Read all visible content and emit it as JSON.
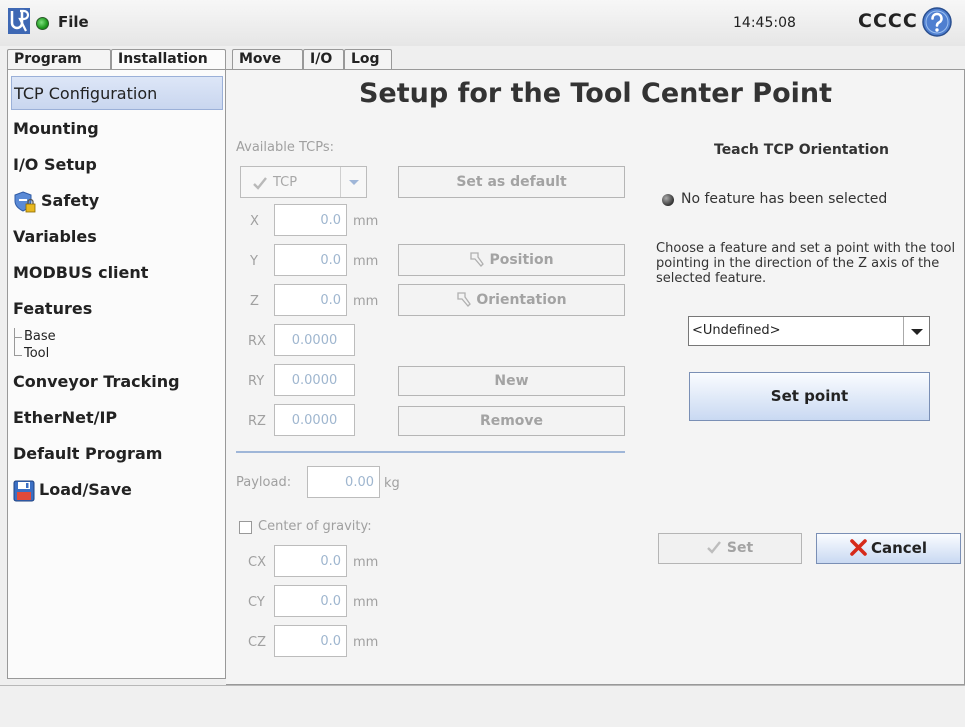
{
  "header": {
    "file_menu": "File",
    "time": "14:45:08",
    "robot_name": "CCCC"
  },
  "tabs": [
    {
      "label": "Program"
    },
    {
      "label": "Installation"
    },
    {
      "label": "Move"
    },
    {
      "label": "I/O"
    },
    {
      "label": "Log"
    }
  ],
  "sidebar": {
    "items": [
      {
        "label": "TCP Configuration"
      },
      {
        "label": "Mounting"
      },
      {
        "label": "I/O Setup"
      },
      {
        "label": "Safety"
      },
      {
        "label": "Variables"
      },
      {
        "label": "MODBUS client"
      },
      {
        "label": "Features"
      },
      {
        "label": "Conveyor Tracking"
      },
      {
        "label": "EtherNet/IP"
      },
      {
        "label": "Default Program"
      },
      {
        "label": "Load/Save"
      }
    ],
    "feature_children": [
      "Base",
      "Tool"
    ]
  },
  "main": {
    "title": "Setup for the Tool Center Point",
    "available_tcps_label": "Available TCPs:",
    "tcp_select_value": "TCP",
    "set_default_label": "Set as default",
    "fields": [
      {
        "axis": "X",
        "value": "0.0",
        "unit": "mm"
      },
      {
        "axis": "Y",
        "value": "0.0",
        "unit": "mm"
      },
      {
        "axis": "Z",
        "value": "0.0",
        "unit": "mm"
      },
      {
        "axis": "RX",
        "value": "0.0000"
      },
      {
        "axis": "RY",
        "value": "0.0000"
      },
      {
        "axis": "RZ",
        "value": "0.0000"
      }
    ],
    "position_label": "Position",
    "orientation_label": "Orientation",
    "new_label": "New",
    "remove_label": "Remove",
    "payload_label": "Payload:",
    "payload_value": "0.00",
    "payload_unit": "kg",
    "cog_label": "Center of gravity:",
    "cog_fields": [
      {
        "axis": "CX",
        "value": "0.0",
        "unit": "mm"
      },
      {
        "axis": "CY",
        "value": "0.0",
        "unit": "mm"
      },
      {
        "axis": "CZ",
        "value": "0.0",
        "unit": "mm"
      }
    ]
  },
  "teach": {
    "heading": "Teach TCP Orientation",
    "status": "No feature has been selected",
    "instructions": "Choose a feature and set a point with the tool pointing in the direction of the Z axis of the selected feature.",
    "feature_select_value": "<Undefined>",
    "set_point_label": "Set point",
    "set_label": "Set",
    "cancel_label": "Cancel"
  },
  "colors": {
    "accent_blue": "#c9d9f2",
    "cancel_x": "#d62a1a",
    "status_green": "#1f9a1f"
  }
}
